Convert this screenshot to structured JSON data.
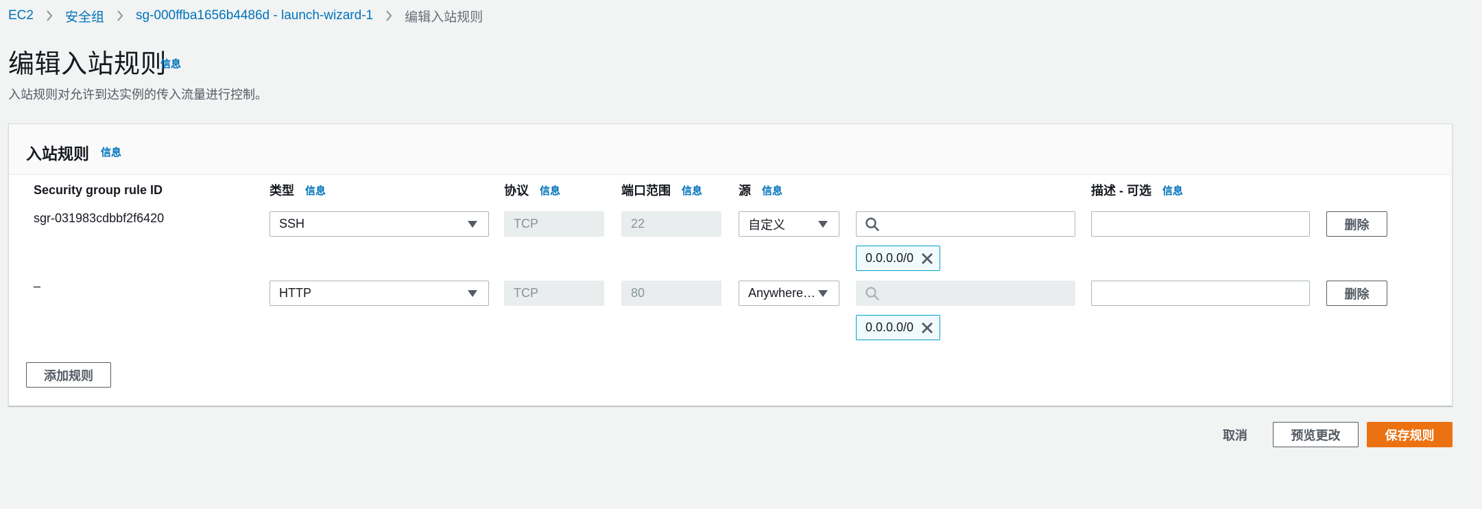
{
  "breadcrumb": {
    "items": [
      "EC2",
      "安全组",
      "sg-000ffba1656b4486d - launch-wizard-1"
    ],
    "current": "编辑入站规则"
  },
  "header": {
    "title": "编辑入站规则",
    "info": "信息",
    "description": "入站规则对允许到达实例的传入流量进行控制。"
  },
  "panel": {
    "title": "入站规则",
    "info": "信息",
    "columns": {
      "rule_id": "Security group rule ID",
      "type": "类型",
      "type_info": "信息",
      "protocol": "协议",
      "protocol_info": "信息",
      "port_range": "端口范围",
      "port_range_info": "信息",
      "source": "源",
      "source_info": "信息",
      "description": "描述 - 可选",
      "description_info": "信息"
    },
    "rules": [
      {
        "rule_id": "sgr-031983cdbbf2f6420",
        "type": "SSH",
        "protocol": "TCP",
        "port_range": "22",
        "source": "自定义",
        "search_value": "",
        "cidr": "0.0.0.0/0",
        "description": "",
        "delete_label": "删除"
      },
      {
        "rule_id": "–",
        "type": "HTTP",
        "protocol": "TCP",
        "port_range": "80",
        "source": "Anywhere…",
        "search_value": "",
        "cidr": "0.0.0.0/0",
        "description": "",
        "delete_label": "删除"
      }
    ],
    "add_rule_label": "添加规则"
  },
  "footer": {
    "cancel_label": "取消",
    "preview_label": "预览更改",
    "save_label": "保存规则"
  },
  "colors": {
    "link": "#0073bb",
    "primary": "#ec7211",
    "background": "#f2f3f3",
    "token_border": "#00a1c9"
  }
}
